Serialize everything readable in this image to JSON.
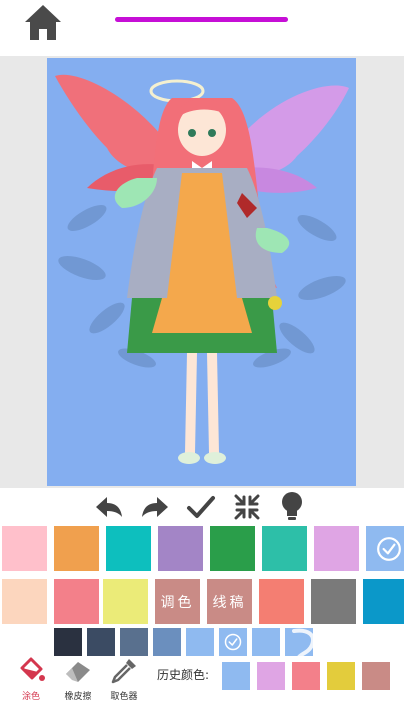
{
  "top": {
    "home_icon": "home-icon",
    "progress_fraction": 1.0,
    "progress_color": "#c60fd6"
  },
  "toolbar": {
    "items": [
      "undo-icon",
      "redo-icon",
      "check-icon",
      "collapse-icon",
      "lightbulb-icon"
    ]
  },
  "palette": {
    "row1": [
      "#ffc0cb",
      "#f0a04e",
      "#0dbfbe",
      "#a385c6",
      "#2a9e4a",
      "#2dbfa8",
      "#dfa5e4",
      "#8fbaf0"
    ],
    "row1_selected_index": 7,
    "row2_colors": [
      "#fcd6be",
      "#f3808a",
      "#ebeb78",
      "#f47e72",
      "#7a7a7a",
      "#0b98c9"
    ],
    "adjust_label": "调色",
    "draft_label": "线稿",
    "text_button_color": "#c98b86",
    "row3": [
      "#2a3140",
      "#3b4b63",
      "#59708e",
      "#6b8fbe",
      "#8fbaf0",
      "#8fbaf0",
      "#8fbaf0",
      "#8fbaf0"
    ],
    "row3_selected_index": 5
  },
  "bottom": {
    "fill_label": "涂色",
    "eraser_label": "橡皮擦",
    "picker_label": "取色器",
    "history_label": "历史颜色:",
    "history_colors": [
      "#8fbaf0",
      "#dfa5e4",
      "#f3808a",
      "#e3cc3c",
      "#c98b86"
    ]
  }
}
